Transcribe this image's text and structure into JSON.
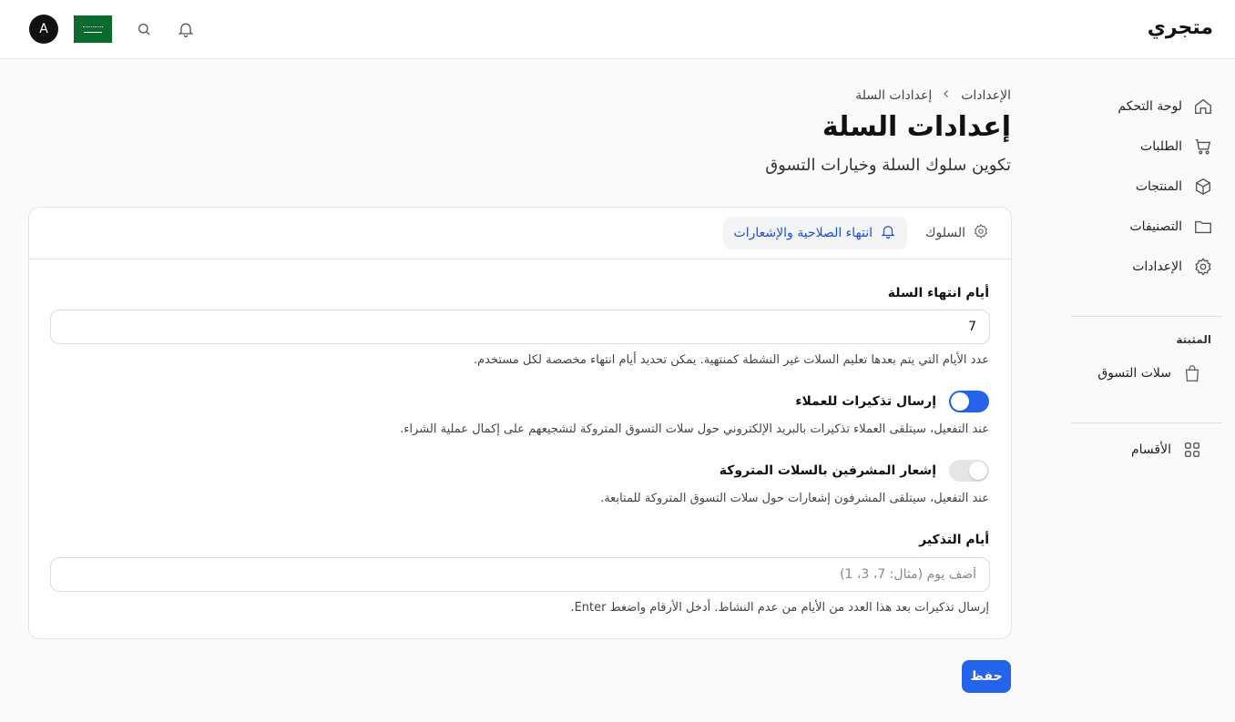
{
  "app": {
    "title": "متجري",
    "avatar_initial": "A"
  },
  "topbar": {
    "flag": "saudi-flag",
    "search_icon": "search-icon",
    "bell_icon": "bell-icon"
  },
  "sidebar": {
    "items": [
      {
        "label": "لوحة التحكم",
        "icon": "home-icon"
      },
      {
        "label": "الطلبات",
        "icon": "cart-icon"
      },
      {
        "label": "المنتجات",
        "icon": "box-icon"
      },
      {
        "label": "التصنيفات",
        "icon": "folder-icon"
      },
      {
        "label": "الإعدادات",
        "icon": "gear-icon"
      }
    ],
    "pinned_label": "المثبتة",
    "pinned": [
      {
        "label": "سلات التسوق",
        "icon": "shopping-bag-icon"
      }
    ],
    "sections": {
      "label": "الأقسام",
      "icon": "grid-icon"
    }
  },
  "breadcrumb": {
    "parent": "الإعدادات",
    "current": "إعدادات السلة"
  },
  "page": {
    "title": "إعدادات السلة",
    "subtitle": "تكوين سلوك السلة وخيارات التسوق"
  },
  "tabs": [
    {
      "label": "السلوك",
      "icon": "gear-icon",
      "active": false
    },
    {
      "label": "انتهاء الصلاحية والإشعارات",
      "icon": "bell-icon",
      "active": true
    }
  ],
  "form": {
    "expiry_days": {
      "label": "أيام انتهاء السلة",
      "value": "7",
      "help": "عدد الأيام التي يتم بعدها تعليم السلات غير النشطة كمنتهية. يمكن تحديد أيام انتهاء مخصصة لكل مستخدم."
    },
    "send_reminders": {
      "label": "إرسال تذكيرات للعملاء",
      "on": true,
      "help": "عند التفعيل، سيتلقى العملاء تذكيرات بالبريد الإلكتروني حول سلات التسوق المتروكة لتشجيعهم على إكمال عملية الشراء."
    },
    "notify_admins": {
      "label": "إشعار المشرفين بالسلات المتروكة",
      "on": false,
      "help": "عند التفعيل، سيتلقى المشرفون إشعارات حول سلات التسوق المتروكة للمتابعة."
    },
    "reminder_days": {
      "label": "أيام التذكير",
      "placeholder": "أضف يوم (مثال: 7، 3، 1)",
      "help": "إرسال تذكيرات بعد هذا العدد من الأيام من عدم النشاط. أدخل الأرقام واضغط Enter."
    }
  },
  "actions": {
    "save_label": "حفظ"
  },
  "colors": {
    "accent": "#2563eb",
    "flag_green": "#0a6b2c"
  }
}
